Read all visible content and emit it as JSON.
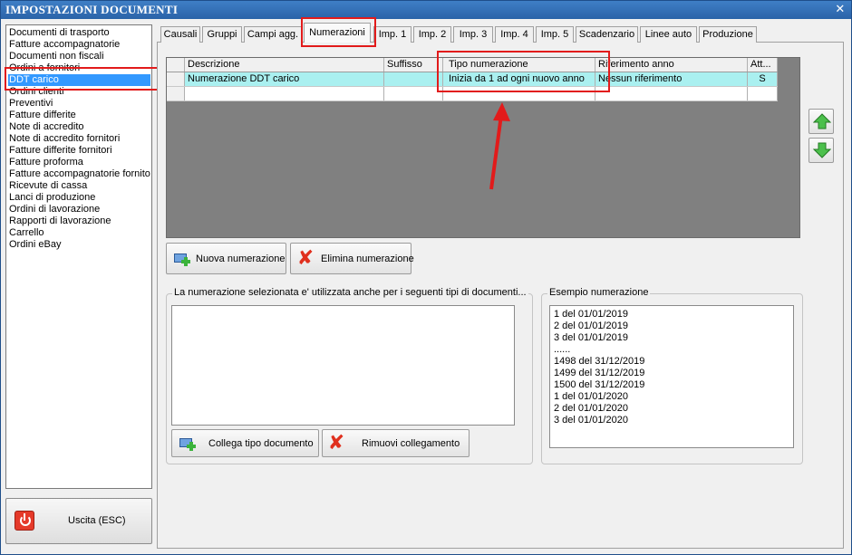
{
  "window": {
    "title": "IMPOSTAZIONI DOCUMENTI",
    "close_glyph": "✕"
  },
  "sidebar": {
    "items": [
      {
        "label": "Documenti di trasporto"
      },
      {
        "label": "Fatture accompagnatorie"
      },
      {
        "label": "Documenti non fiscali"
      },
      {
        "label": "Ordini a fornitori"
      },
      {
        "label": "DDT carico",
        "selected": true
      },
      {
        "label": "Ordini clienti"
      },
      {
        "label": "Preventivi"
      },
      {
        "label": "Fatture differite"
      },
      {
        "label": "Note di accredito"
      },
      {
        "label": "Note di accredito fornitori"
      },
      {
        "label": "Fatture differite fornitori"
      },
      {
        "label": "Fatture proforma"
      },
      {
        "label": "Fatture accompagnatorie fornito"
      },
      {
        "label": "Ricevute di cassa"
      },
      {
        "label": "Lanci di produzione"
      },
      {
        "label": "Ordini di lavorazione"
      },
      {
        "label": "Rapporti di lavorazione"
      },
      {
        "label": "Carrello"
      },
      {
        "label": "Ordini eBay"
      }
    ],
    "exit_label": "Uscita (ESC)"
  },
  "tabs": [
    {
      "label": "Causali"
    },
    {
      "label": "Gruppi"
    },
    {
      "label": "Campi agg."
    },
    {
      "label": "Numerazioni",
      "active": true
    },
    {
      "label": "Imp. 1"
    },
    {
      "label": "Imp. 2"
    },
    {
      "label": "Imp. 3"
    },
    {
      "label": "Imp. 4"
    },
    {
      "label": "Imp. 5"
    },
    {
      "label": "Scadenzario"
    },
    {
      "label": "Linee auto"
    },
    {
      "label": "Produzione"
    }
  ],
  "grid": {
    "columns": [
      "Descrizione",
      "Suffisso",
      "Tipo numerazione",
      "Riferimento anno",
      "Att..."
    ],
    "rows": [
      [
        "Numerazione DDT carico",
        "",
        "Inizia da 1 ad ogni nuovo anno",
        "Nessun riferimento",
        "S"
      ]
    ]
  },
  "actions": {
    "new_label": "Nuova numerazione",
    "delete_label": "Elimina numerazione"
  },
  "linked_group": {
    "legend": "La numerazione selezionata e' utilizzata anche per i seguenti tipi di documenti...",
    "link_label": "Collega tipo documento",
    "unlink_label": "Rimuovi collegamento"
  },
  "example_group": {
    "legend": "Esempio numerazione",
    "lines": [
      "1 del 01/01/2019",
      "2 del 01/01/2019",
      "3 del 01/01/2019",
      "......",
      "1498 del 31/12/2019",
      "1499 del 31/12/2019",
      "1500 del 31/12/2019",
      "1 del 01/01/2020",
      "2 del 01/01/2020",
      "3 del 01/01/2020"
    ]
  },
  "colors": {
    "title_bar": "#2f6cb2",
    "selection": "#3399ff",
    "row_highlight": "#aaf0f0",
    "annotation_red": "#e21b1b"
  }
}
